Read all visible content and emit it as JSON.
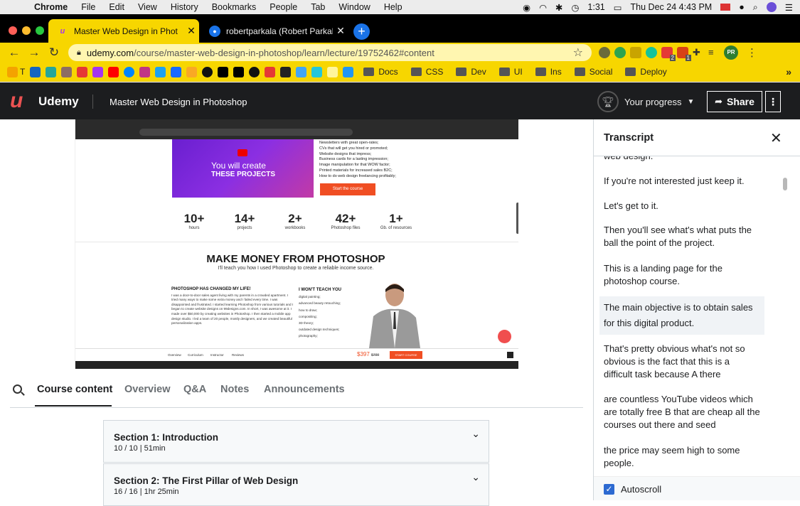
{
  "macos": {
    "app": "Chrome",
    "menus": [
      "File",
      "Edit",
      "View",
      "History",
      "Bookmarks",
      "People",
      "Tab",
      "Window",
      "Help"
    ],
    "time": "1:31",
    "datetime": "Thu Dec 24  4:43 PM"
  },
  "browser": {
    "tabs": [
      {
        "title": "Master Web Design in Phot",
        "close": "✕"
      },
      {
        "title": "robertparkala (Robert Parkala)",
        "close": "✕"
      }
    ],
    "new_tab": "+",
    "url_host": "udemy.com",
    "url_path": "/course/master-web-design-in-photoshop/learn/lecture/19752462#content",
    "profile": "PR",
    "ext_badges": [
      "2",
      "1"
    ],
    "bookmarks": {
      "first": "T",
      "folders": [
        "Docs",
        "CSS",
        "Dev",
        "UI",
        "Ins",
        "Social",
        "Deploy"
      ],
      "overflow": "»"
    }
  },
  "udemy": {
    "logo": "Udemy",
    "course_title": "Master Web Design in Photoshop",
    "progress_label": "Your progress",
    "share_label": "Share",
    "more": "⋮"
  },
  "video": {
    "hero_line1": "You will create",
    "hero_line2": "THESE PROJECTS",
    "checks": [
      "Newsletters with great open-rates;",
      "CVs that will get you hired or promoted;",
      "Website designs that impress;",
      "Business cards for a lasting impression;",
      "Image manipulation for that WOW factor;",
      "Printed materials for increased sales B2C;",
      "How to do web design freelancing profitably;"
    ],
    "cta": "Start the course",
    "stats": [
      {
        "n": "10+",
        "l": "hours"
      },
      {
        "n": "14+",
        "l": "projects"
      },
      {
        "n": "2+",
        "l": "workbooks"
      },
      {
        "n": "42+",
        "l": "Photoshop files"
      },
      {
        "n": "1+",
        "l": "Gb. of resources"
      }
    ],
    "headline": "MAKE MONEY FROM PHOTOSHOP",
    "subhead": "I'll teach you how I used Photoshop to create a reliable income source.",
    "col1_head": "PHOTOSHOP HAS CHANGED MY LIFE!",
    "col1_text": "I was a door-to-door sales agent living with my parents in a crowded apartment. I tried many ways to make some extra money and I failed every time. I was disappointed and frustrated. I started learning Photoshop from various tutorials and I began to create website designs on 99designs.com. In short, I was awesome at it. I made over $50,000 by creating websites in Photoshop. I then started a mobile app design studio. I led a team of 20 people, mostly designers, and we created beautiful personalization apps.",
    "col2_head": "I WON'T TEACH YOU",
    "col2_items": [
      "digital painting;",
      "advanced beauty retouching;",
      "how to draw;",
      "compositing;",
      "3D theory;",
      "outdated design techniques;",
      "photography;"
    ],
    "bottom_nav": [
      "Overview",
      "Curriculum",
      "Instructor",
      "Reviews"
    ],
    "price": "$397",
    "old_price": "$799",
    "start": "START COURSE"
  },
  "content_tabs": [
    "Course content",
    "Overview",
    "Q&A",
    "Notes",
    "Announcements"
  ],
  "sections": [
    {
      "title": "Section 1: Introduction",
      "meta": "10 / 10 | 51min"
    },
    {
      "title": "Section 2: The First Pillar of Web Design",
      "meta": "16 / 16 | 1hr 25min"
    }
  ],
  "transcript": {
    "title": "Transcript",
    "close": "✕",
    "cues": [
      "web design.",
      "If you're not interested just keep it.",
      "Let's get to it.",
      "Then you'll see what's what puts the ball the point of the project.",
      "This is a landing page for the photoshop course.",
      "The main objective is to obtain sales for this digital product.",
      "That's pretty obvious what's not so obvious is the fact that this is a difficult task because A there",
      "are countless YouTube videos which are totally free B that are cheap all the courses out there and seed",
      "the price may seem high to some people."
    ],
    "active_cue": 5,
    "autoscroll": "Autoscroll"
  }
}
